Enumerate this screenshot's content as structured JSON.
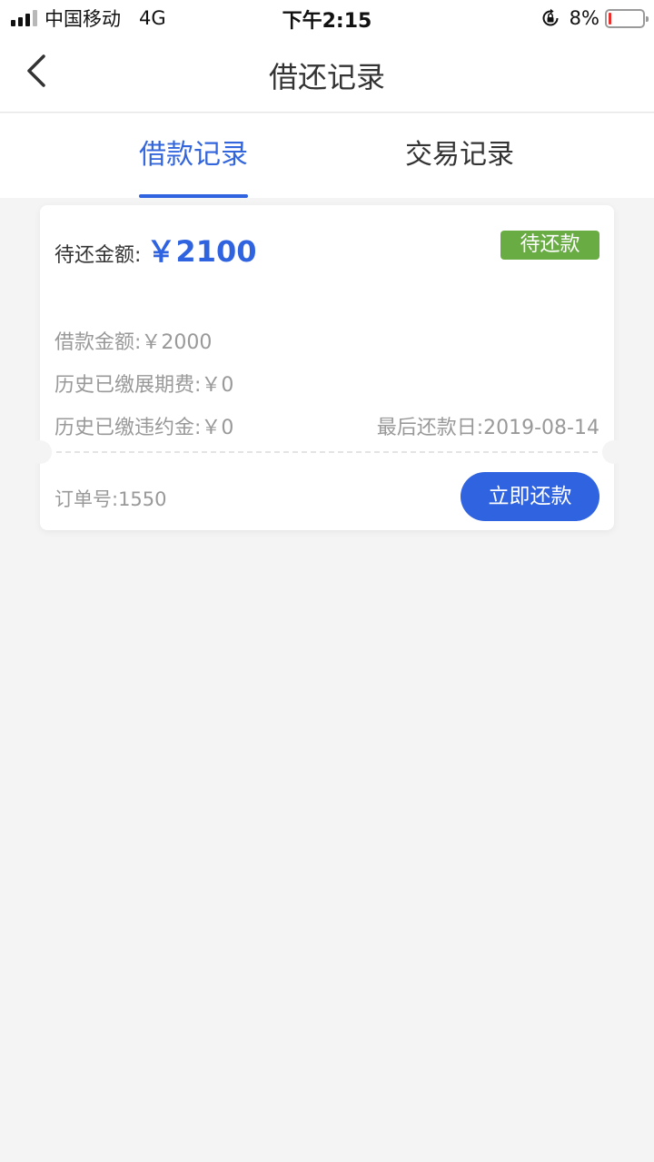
{
  "status_bar": {
    "carrier": "中国移动",
    "network": "4G",
    "time": "下午2:15",
    "battery_percent": "8%",
    "battery_level": 0.08,
    "icons": [
      "signal-icon",
      "orientation-lock-icon",
      "battery-icon"
    ]
  },
  "nav": {
    "back_icon": "chevron-left-icon",
    "title": "借还记录"
  },
  "tabs": [
    {
      "label": "借款记录",
      "active": true
    },
    {
      "label": "交易记录",
      "active": false
    }
  ],
  "record": {
    "due_label": "待还金额:",
    "due_amount": "￥2100",
    "status": "待还款",
    "loan_amount": "借款金额:￥2000",
    "extension_fee": "历史已缴展期费:￥0",
    "penalty": "历史已缴违约金:￥0",
    "last_due_date": "最后还款日:2019-08-14",
    "order_no": "订单号:1550",
    "action_label": "立即还款"
  },
  "colors": {
    "accent": "#2f63e0",
    "status_badge": "#6aac44",
    "background": "#f4f4f4",
    "muted_text": "#999999",
    "battery_low": "#e8312f"
  }
}
